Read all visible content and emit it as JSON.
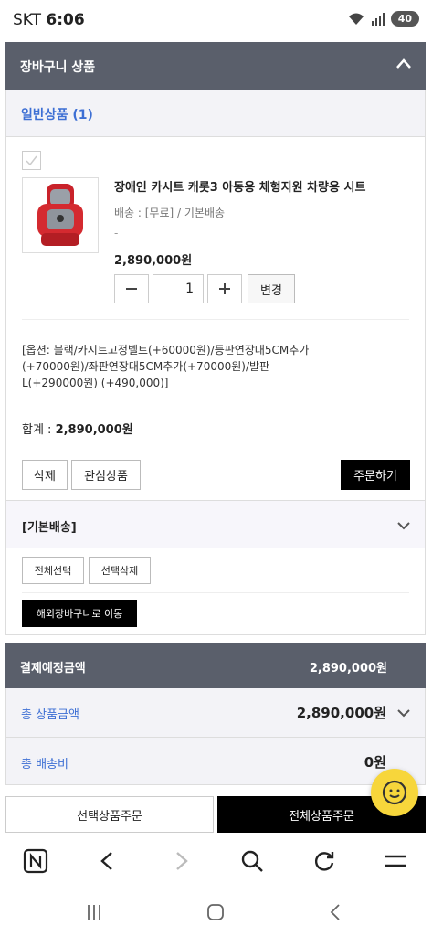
{
  "status_bar": {
    "carrier": "SKT",
    "time": "6:06",
    "battery": "40"
  },
  "cart_header": {
    "title": "장바구니 상품",
    "collapse_icon": "chevron-up-icon"
  },
  "general_section": {
    "label": "일반상품 (1)"
  },
  "item": {
    "name": "장애인 카시트 캐롯3 아동용 체형지원 차량용 시트",
    "shipping": "배송 : [무료] / 기본배송",
    "dash": "-",
    "price": "2,890,000원",
    "quantity": "1",
    "change_label": "변경",
    "options": "[옵션: 블랙/카시트고정벨트(+60000원)/등판연장대5CM추가(+70000원)/좌판연장대5CM추가(+70000원)/발판L(+290000원) (+490,000)]",
    "total_label": "합계 : ",
    "total_value": "2,890,000원",
    "delete_label": "삭제",
    "interest_label": "관심상품",
    "order_label": "주문하기"
  },
  "basic_shipping": {
    "label": "[기본배송]"
  },
  "selection": {
    "select_all": "전체선택",
    "delete_selected": "선택삭제",
    "overseas": "해외장바구니로 이동"
  },
  "payment": {
    "head_label": "결제예정금액",
    "head_value": "2,890,000원",
    "product_total_label": "총 상품금액",
    "product_total_value": "2,890,000원",
    "shipping_label": "총 배송비",
    "shipping_value": "0원"
  },
  "bottom_buttons": {
    "order_selected": "선택상품주문",
    "order_all": "전체상품주문"
  },
  "colors": {
    "header": "#5a5f6b",
    "link": "#3d6fd4",
    "chat": "#f7d63b"
  }
}
